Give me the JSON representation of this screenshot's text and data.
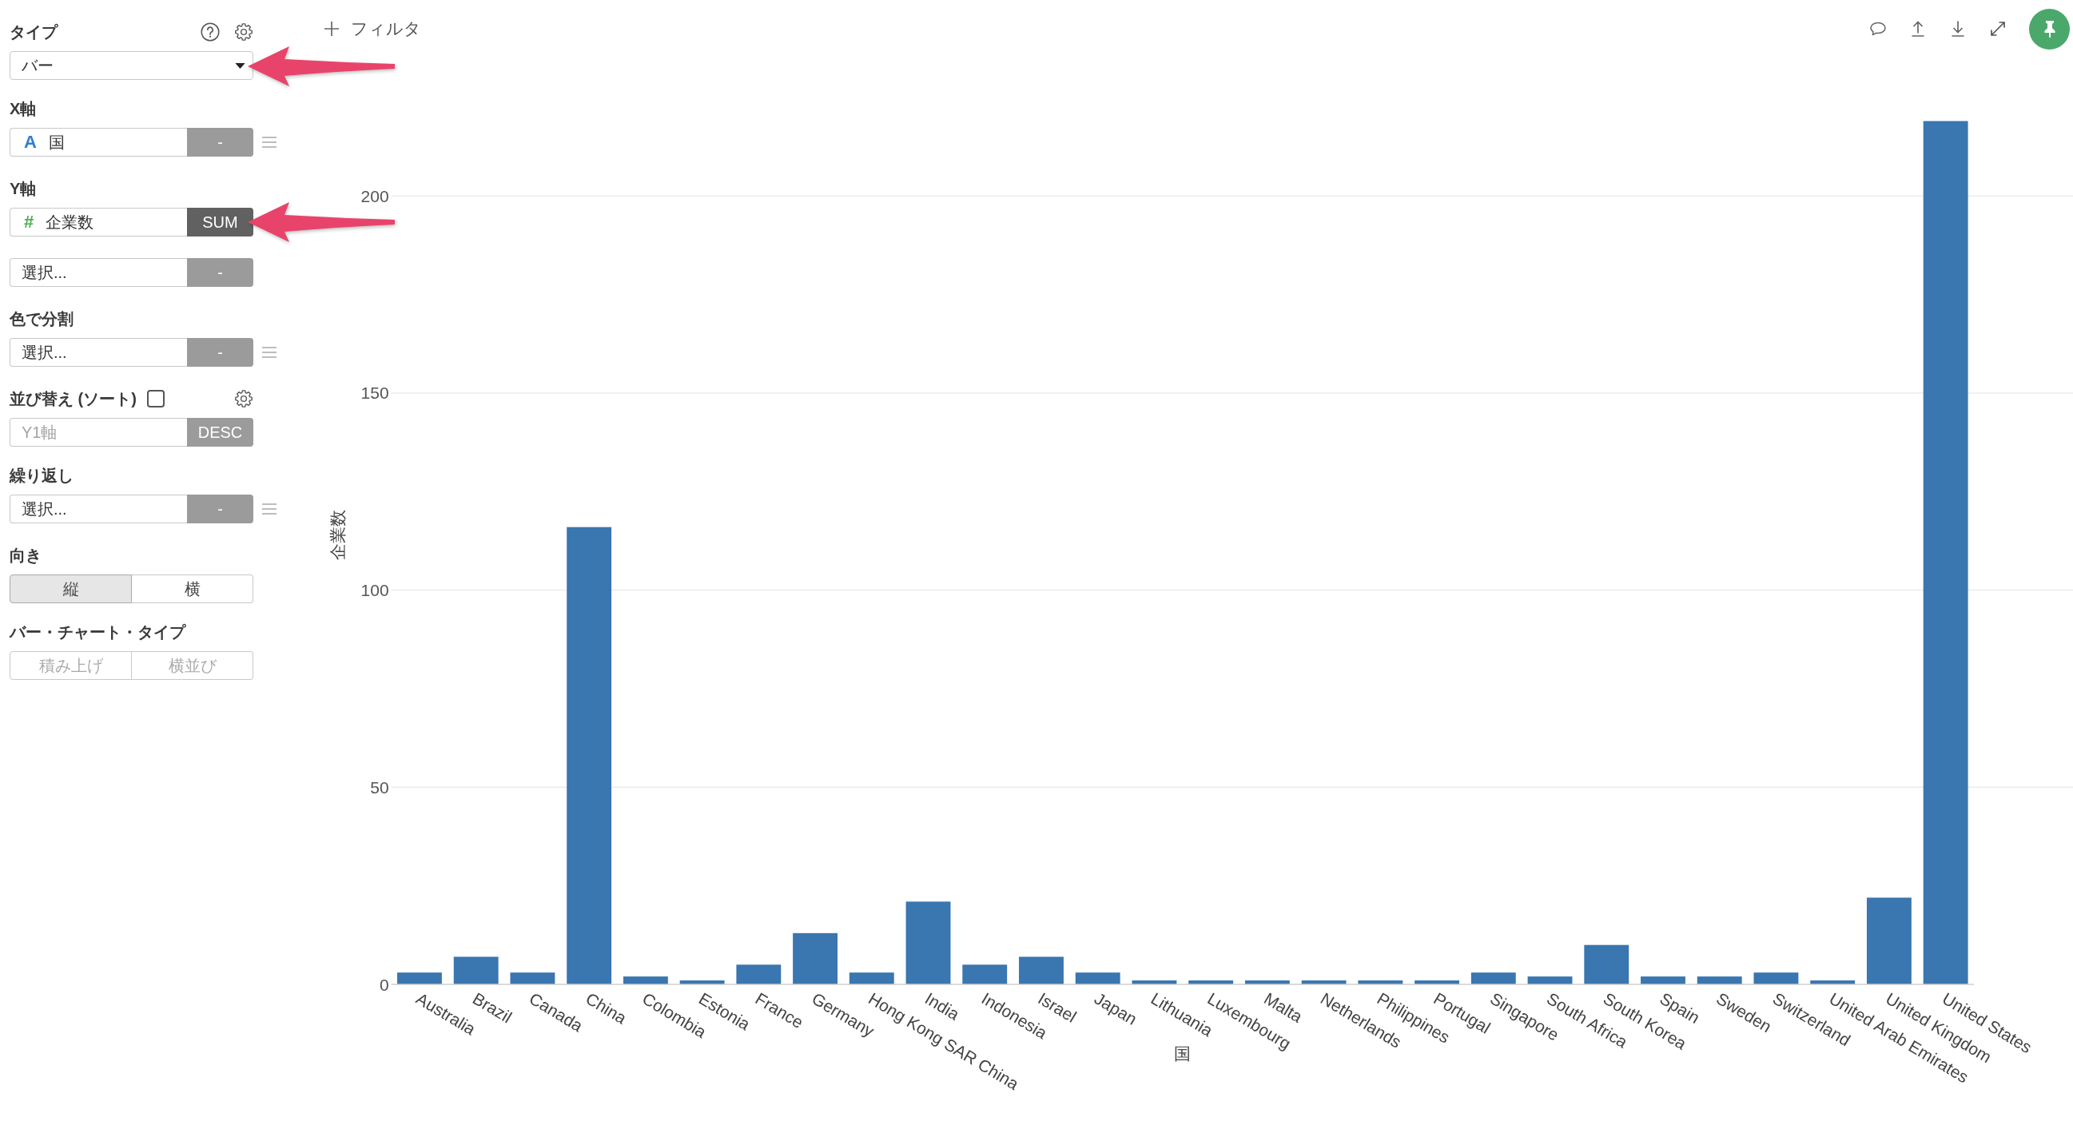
{
  "sidebar": {
    "sections": [
      {
        "kind": "select",
        "label": "タイプ",
        "value": "バー"
      },
      {
        "kind": "fields",
        "label": "X軸",
        "rows": [
          {
            "type_mark": {
              "text": "A",
              "color": "#2f7fd0"
            },
            "value": "国",
            "disabled": false,
            "agg": {
              "label": "-",
              "active": false
            },
            "menu": true
          }
        ]
      },
      {
        "kind": "fields",
        "label": "Y軸",
        "rows": [
          {
            "type_mark": {
              "text": "#",
              "color": "#4caf50"
            },
            "value": "企業数",
            "disabled": false,
            "agg": {
              "label": "SUM",
              "active": true
            },
            "menu": false
          },
          {
            "placeholder": "選択...",
            "disabled": false,
            "agg": {
              "label": "-",
              "active": false
            },
            "menu": false
          }
        ]
      },
      {
        "kind": "fields",
        "label": "色で分割",
        "rows": [
          {
            "placeholder": "選択...",
            "disabled": false,
            "agg": {
              "label": "-",
              "active": false
            },
            "menu": true
          }
        ]
      },
      {
        "kind": "sort",
        "label": "並び替え (ソート)",
        "checked": false,
        "rows": [
          {
            "placeholder": "Y1軸",
            "disabled": true,
            "agg": {
              "label": "DESC",
              "active": false
            },
            "menu": false
          }
        ]
      },
      {
        "kind": "fields",
        "label": "繰り返し",
        "rows": [
          {
            "placeholder": "選択...",
            "disabled": false,
            "agg": {
              "label": "-",
              "active": false
            },
            "menu": true
          }
        ]
      },
      {
        "kind": "segmented",
        "label": "向き",
        "disabled": false,
        "options": [
          {
            "label": "縦",
            "selected": true
          },
          {
            "label": "横",
            "selected": false
          }
        ]
      },
      {
        "kind": "segmented",
        "label": "バー・チャート・タイプ",
        "disabled": true,
        "options": [
          {
            "label": "積み上げ",
            "selected": false
          },
          {
            "label": "横並び",
            "selected": false
          }
        ]
      }
    ]
  },
  "filter_button": {
    "label": "フィルタ"
  },
  "toolbar": {
    "pinned": true
  },
  "chart": {
    "chart_data": {
      "type": "bar",
      "xlabel": "国",
      "ylabel": "企業数",
      "categories": [
        "Australia",
        "Brazil",
        "Canada",
        "China",
        "Colombia",
        "Estonia",
        "France",
        "Germany",
        "Hong Kong SAR China",
        "India",
        "Indonesia",
        "Israel",
        "Japan",
        "Lithuania",
        "Luxembourg",
        "Malta",
        "Netherlands",
        "Philippines",
        "Portugal",
        "Singapore",
        "South Africa",
        "South Korea",
        "Spain",
        "Sweden",
        "Switzerland",
        "United Arab Emirates",
        "United Kingdom",
        "United States"
      ],
      "values": [
        3,
        7,
        3,
        116,
        2,
        1,
        5,
        13,
        3,
        21,
        5,
        7,
        3,
        1,
        1,
        1,
        1,
        1,
        1,
        3,
        2,
        10,
        2,
        2,
        3,
        1,
        22,
        219
      ],
      "ylim": [
        0,
        219
      ],
      "yticks": [
        0,
        50,
        100,
        150,
        200
      ],
      "grid": true
    }
  }
}
